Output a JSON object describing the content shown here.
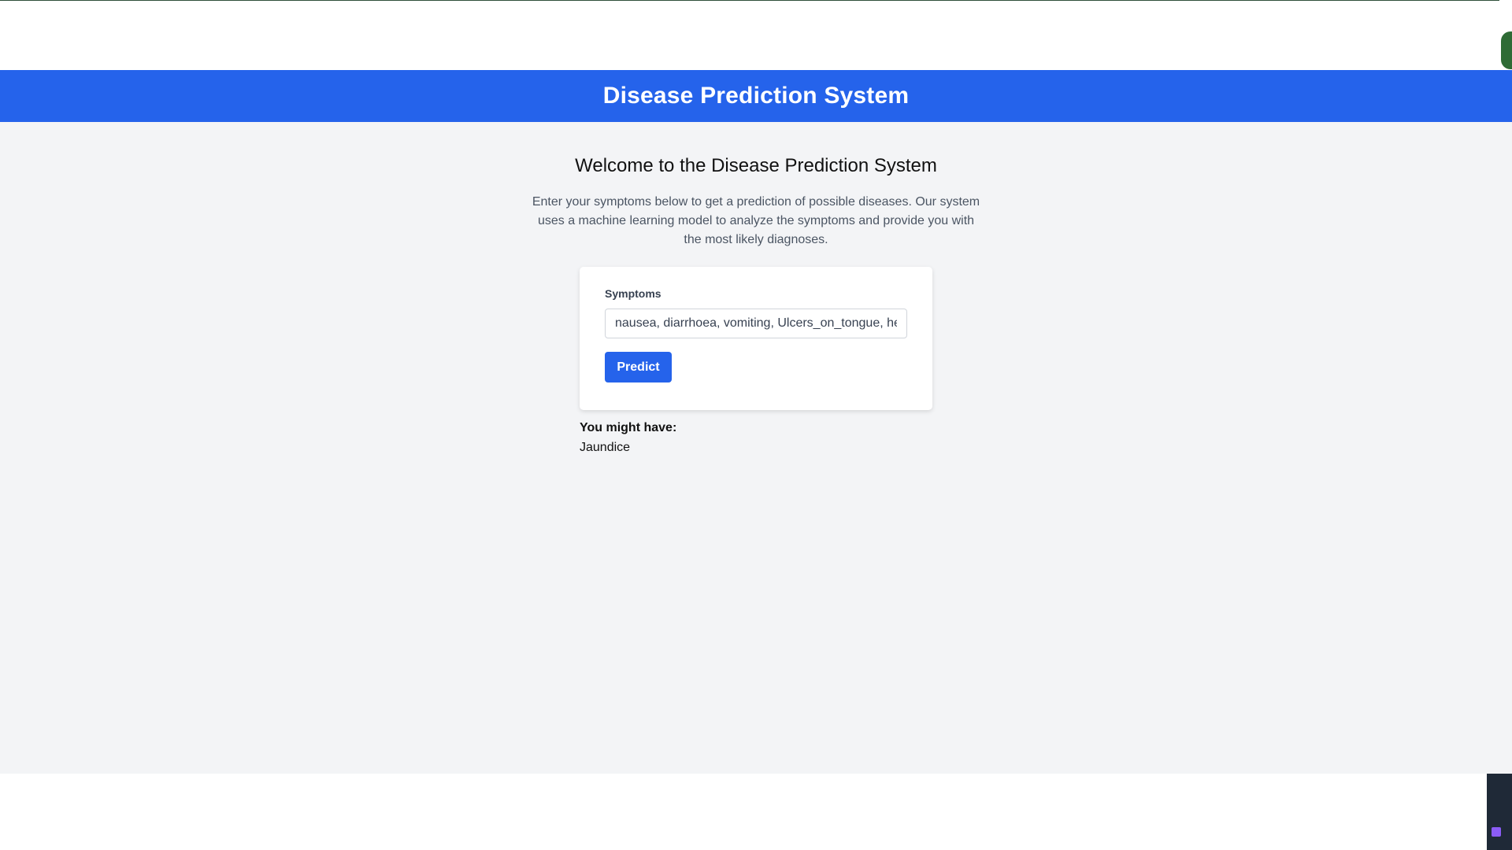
{
  "header": {
    "title": "Disease Prediction System"
  },
  "main": {
    "welcome_title": "Welcome to the Disease Prediction System",
    "intro": "Enter your symptoms below to get a prediction of possible diseases. Our system uses a machine learning model to analyze the symptoms and provide you with the most likely diagnoses."
  },
  "form": {
    "symptoms_label": "Symptoms",
    "symptoms_value": "nausea, diarrhoea, vomiting, Ulcers_on_tongue, headache",
    "predict_label": "Predict"
  },
  "result": {
    "heading": "You might have:",
    "value": "Jaundice"
  },
  "colors": {
    "primary": "#2563eb",
    "page_background": "#f3f4f6"
  }
}
